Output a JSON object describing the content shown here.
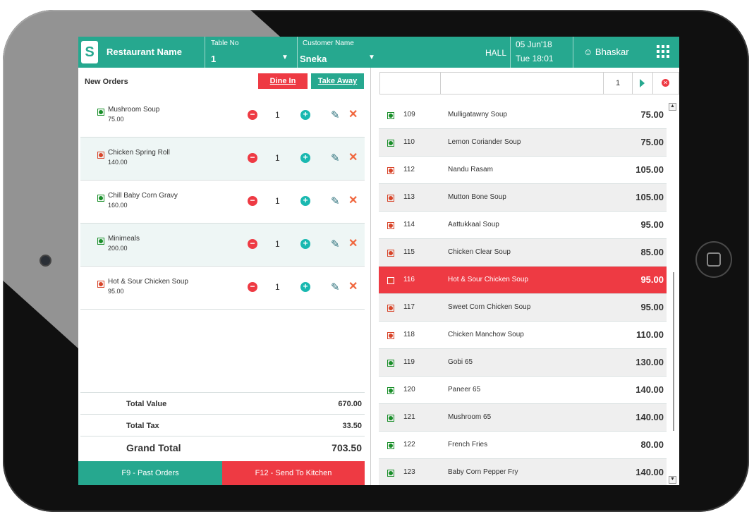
{
  "header": {
    "logo_glyph": "S",
    "restaurant_name": "Restaurant Name",
    "table_label": "Table No",
    "table_value": "1",
    "customer_label": "Customer Name",
    "customer_value": "Sneka",
    "hall": "HALL",
    "date": "05 Jun'18",
    "time": "Tue 18:01",
    "user": "Bhaskar"
  },
  "orders": {
    "title": "New Orders",
    "dine_in": "Dine In",
    "take_away": "Take Away",
    "items": [
      {
        "name": "Mushroom Soup",
        "price": "75.00",
        "qty": "1",
        "veg": true
      },
      {
        "name": "Chicken Spring Roll",
        "price": "140.00",
        "qty": "1",
        "veg": false
      },
      {
        "name": "Chill Baby Corn Gravy",
        "price": "160.00",
        "qty": "1",
        "veg": true
      },
      {
        "name": "Minimeals",
        "price": "200.00",
        "qty": "1",
        "veg": true
      },
      {
        "name": "Hot & Sour Chicken Soup",
        "price": "95.00",
        "qty": "1",
        "veg": false
      }
    ],
    "total_value_label": "Total Value",
    "total_value": "670.00",
    "total_tax_label": "Total Tax",
    "total_tax": "33.50",
    "grand_total_label": "Grand Total",
    "grand_total": "703.50",
    "past_orders": "F9 - Past Orders",
    "send_kitchen": "F12 - Send To Kitchen"
  },
  "search": {
    "qty": "1"
  },
  "menu": [
    {
      "code": "109",
      "name": "Mulligatawny Soup",
      "price": "75.00",
      "veg": true
    },
    {
      "code": "110",
      "name": "Lemon Coriander Soup",
      "price": "75.00",
      "veg": true
    },
    {
      "code": "112",
      "name": "Nandu Rasam",
      "price": "105.00",
      "veg": false
    },
    {
      "code": "113",
      "name": "Mutton Bone Soup",
      "price": "105.00",
      "veg": false
    },
    {
      "code": "114",
      "name": "Aattukkaal Soup",
      "price": "95.00",
      "veg": false
    },
    {
      "code": "115",
      "name": "Chicken Clear Soup",
      "price": "85.00",
      "veg": false
    },
    {
      "code": "116",
      "name": "Hot & Sour Chicken Soup",
      "price": "95.00",
      "veg": false,
      "selected": true
    },
    {
      "code": "117",
      "name": "Sweet Corn Chicken Soup",
      "price": "95.00",
      "veg": false
    },
    {
      "code": "118",
      "name": "Chicken Manchow Soup",
      "price": "110.00",
      "veg": false
    },
    {
      "code": "119",
      "name": "Gobi 65",
      "price": "130.00",
      "veg": true
    },
    {
      "code": "120",
      "name": "Paneer 65",
      "price": "140.00",
      "veg": true
    },
    {
      "code": "121",
      "name": "Mushroom 65",
      "price": "140.00",
      "veg": true
    },
    {
      "code": "122",
      "name": "French Fries",
      "price": "80.00",
      "veg": true
    },
    {
      "code": "123",
      "name": "Baby Corn Pepper Fry",
      "price": "140.00",
      "veg": true
    }
  ],
  "colors": {
    "brand": "#26a88f",
    "accent_red": "#ee3a43",
    "veg": "#1a8f2a",
    "nonveg": "#d8452a"
  }
}
